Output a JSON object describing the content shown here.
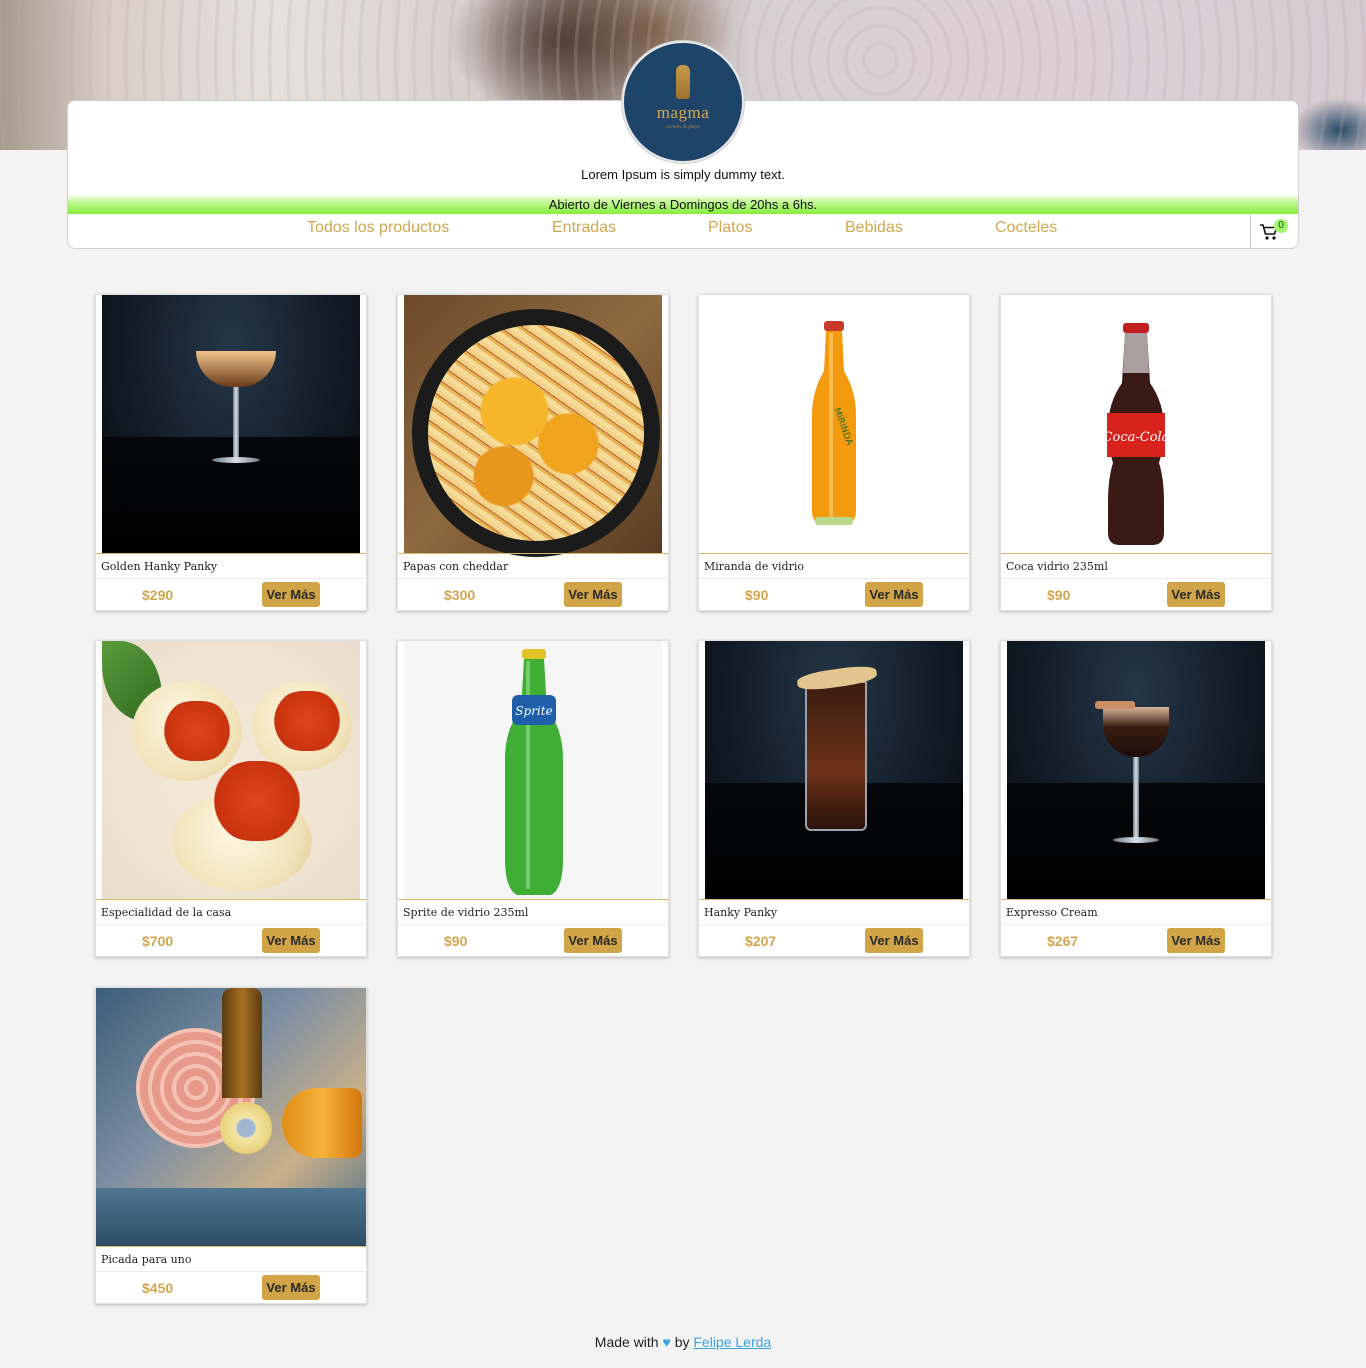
{
  "header": {
    "logo_text": "magma",
    "logo_subtitle": "cocteles & platos",
    "tagline": "Lorem Ipsum is simply dummy text.",
    "hours": "Abierto de Viernes a Domingos de 20hs a 6hs."
  },
  "nav": {
    "items": [
      "Todos los productos",
      "Entradas",
      "Platos",
      "Bebidas",
      "Cocteles"
    ],
    "cart_count": "0"
  },
  "products": [
    {
      "name": "Golden Hanky Panky",
      "price": "$290",
      "button": "Ver Más"
    },
    {
      "name": "Papas con cheddar",
      "price": "$300",
      "button": "Ver Más"
    },
    {
      "name": "Miranda de vidrio",
      "price": "$90",
      "button": "Ver Más"
    },
    {
      "name": "Coca vidrio 235ml",
      "price": "$90",
      "button": "Ver Más"
    },
    {
      "name": "Especialidad de la casa",
      "price": "$700",
      "button": "Ver Más"
    },
    {
      "name": "Sprite de vidrio 235ml",
      "price": "$90",
      "button": "Ver Más"
    },
    {
      "name": "Hanky Panky",
      "price": "$207",
      "button": "Ver Más"
    },
    {
      "name": "Expresso Cream",
      "price": "$267",
      "button": "Ver Más"
    },
    {
      "name": "Picada para uno",
      "price": "$450",
      "button": "Ver Más"
    }
  ],
  "footer": {
    "made_with": "Made with",
    "heart": "♥",
    "by": "by",
    "author": "Felipe Lerda"
  },
  "colors": {
    "accent": "#d1a448",
    "hours_bar": "#86ee3a",
    "logo_bg": "#1e4469",
    "link": "#3aa3e3"
  }
}
